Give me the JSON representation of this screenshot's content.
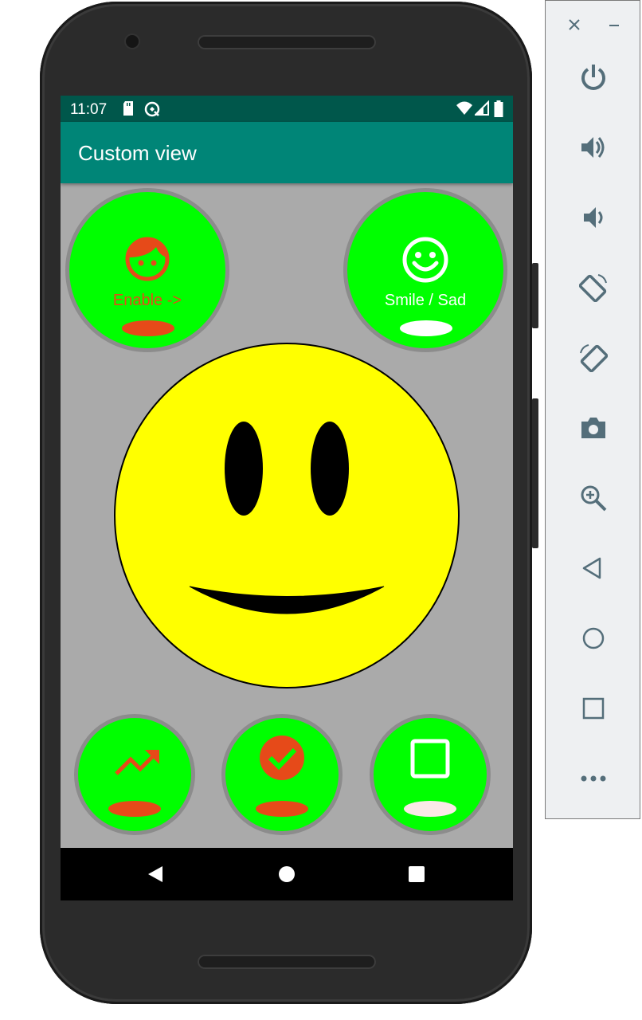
{
  "status_bar": {
    "time": "11:07"
  },
  "app_bar": {
    "title": "Custom view"
  },
  "buttons": {
    "enable": {
      "label": "Enable ->",
      "label_color": "#e64a19",
      "pill_color": "#e64a19"
    },
    "smile_sad": {
      "label": "Smile / Sad",
      "label_color": "#ffffff",
      "pill_color": "#ffffff"
    },
    "trend": {
      "pill_color": "#e64a19"
    },
    "check": {
      "pill_color": "#e64a19"
    },
    "square": {
      "pill_color": "#fbe9e7"
    }
  },
  "colors": {
    "status_bar": "#00574b",
    "app_bar": "#008577",
    "background": "#aaaaaa",
    "button_fill": "#00ff00",
    "button_ring": "#8c8c8c",
    "face": "#ffff00"
  },
  "emulator_controls": [
    "close-icon",
    "minimize-icon",
    "power-icon",
    "volume-up-icon",
    "volume-down-icon",
    "rotate-left-icon",
    "rotate-right-icon",
    "camera-icon",
    "zoom-icon",
    "back-icon",
    "home-icon",
    "overview-icon",
    "more-icon"
  ]
}
